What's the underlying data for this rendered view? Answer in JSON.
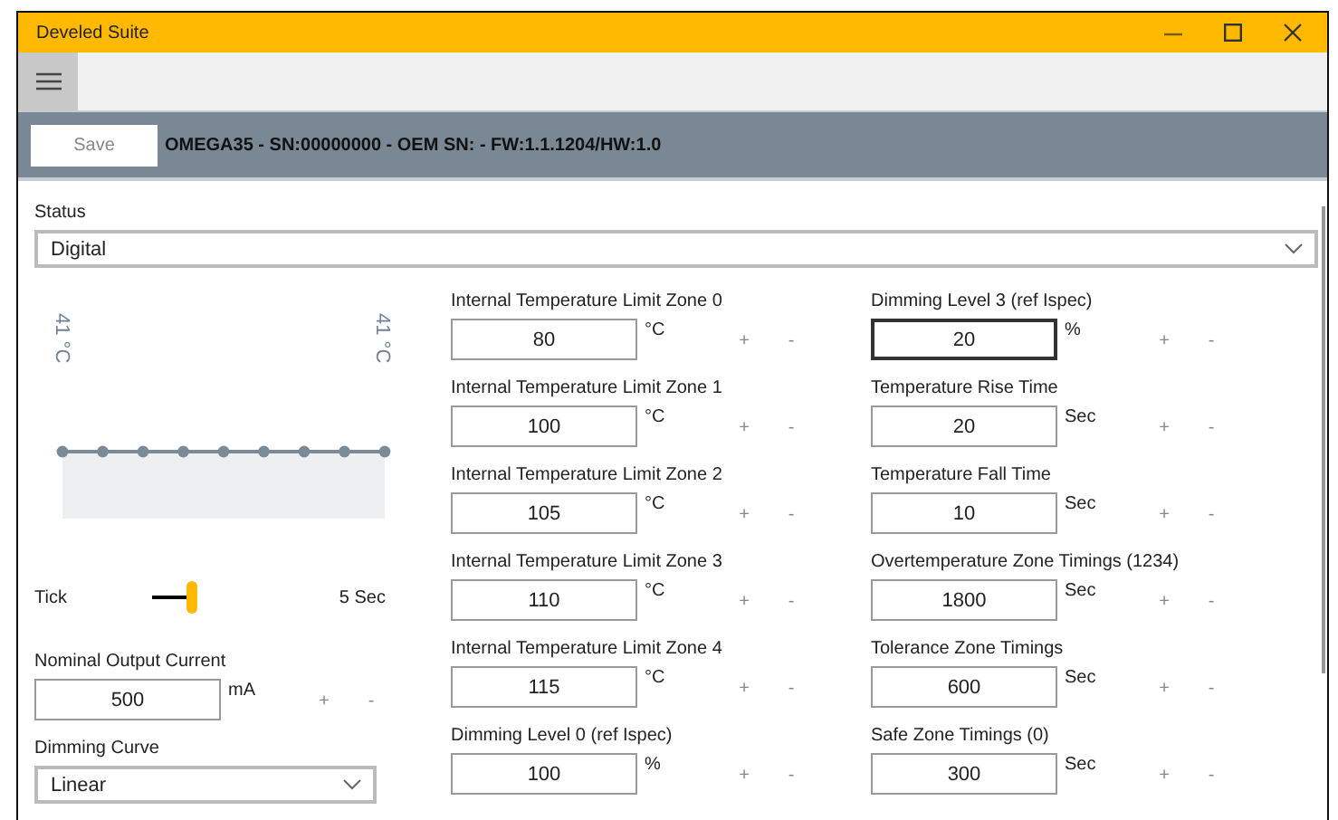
{
  "window": {
    "title": "Develed Suite"
  },
  "header": {
    "save_button": "Save",
    "device_info": "OMEGA35 - SN:00000000 - OEM SN: - FW:1.1.1204/HW:1.0"
  },
  "status": {
    "label": "Status",
    "value": "Digital"
  },
  "thermal_chart": {
    "left_label": "41 °C",
    "right_label": "41 °C"
  },
  "tick": {
    "label": "Tick",
    "level": 1,
    "reading": "5 Sec"
  },
  "left_fields": [
    {
      "kind": "number",
      "label": "Nominal Output Current",
      "value": "500",
      "unit": "mA",
      "plus": "+",
      "minus": "-",
      "focused": false
    },
    {
      "kind": "dropdown",
      "label": "Dimming Curve",
      "value": "Linear"
    }
  ],
  "middle_fields": [
    {
      "label": "Internal Temperature Limit Zone 0",
      "value": "80",
      "unit": "°C",
      "plus": "+",
      "minus": "-",
      "focused": false
    },
    {
      "label": "Internal Temperature Limit Zone 1",
      "value": "100",
      "unit": "°C",
      "plus": "+",
      "minus": "-",
      "focused": false
    },
    {
      "label": "Internal Temperature Limit Zone 2",
      "value": "105",
      "unit": "°C",
      "plus": "+",
      "minus": "-",
      "focused": false
    },
    {
      "label": "Internal Temperature Limit Zone 3",
      "value": "110",
      "unit": "°C",
      "plus": "+",
      "minus": "-",
      "focused": false
    },
    {
      "label": "Internal Temperature Limit Zone 4",
      "value": "115",
      "unit": "°C",
      "plus": "+",
      "minus": "-",
      "focused": false
    },
    {
      "label": "Dimming Level 0 (ref Ispec)",
      "value": "100",
      "unit": "%",
      "plus": "+",
      "minus": "-",
      "focused": false
    }
  ],
  "right_fields": [
    {
      "label": "Dimming Level 3 (ref Ispec)",
      "value": "20",
      "unit": "%",
      "plus": "+",
      "minus": "-",
      "focused": true
    },
    {
      "label": "Temperature Rise Time",
      "value": "20",
      "unit": "Sec",
      "plus": "+",
      "minus": "-",
      "focused": false
    },
    {
      "label": "Temperature Fall Time",
      "value": "10",
      "unit": "Sec",
      "plus": "+",
      "minus": "-",
      "focused": false
    },
    {
      "label": "Overtemperature Zone Timings (1234)",
      "value": "1800",
      "unit": "Sec",
      "plus": "+",
      "minus": "-",
      "focused": false
    },
    {
      "label": "Tolerance Zone Timings",
      "value": "600",
      "unit": "Sec",
      "plus": "+",
      "minus": "-",
      "focused": false
    },
    {
      "label": "Safe Zone Timings (0)",
      "value": "300",
      "unit": "Sec",
      "plus": "+",
      "minus": "-",
      "focused": false
    }
  ]
}
